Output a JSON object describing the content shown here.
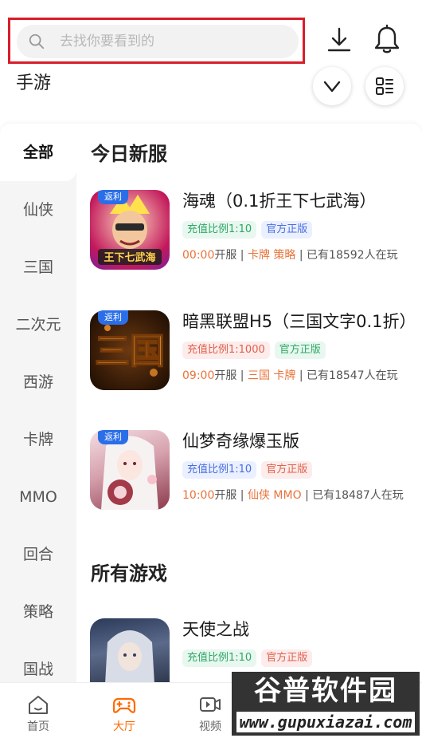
{
  "header": {
    "search_placeholder": "去找你要看到的",
    "page_title": "手游"
  },
  "sidebar": {
    "items": [
      "全部",
      "仙侠",
      "三国",
      "二次元",
      "西游",
      "卡牌",
      "MMO",
      "回合",
      "策略",
      "国战"
    ],
    "active_index": 0
  },
  "sections": {
    "new_servers_title": "今日新服",
    "all_games_title": "所有游戏"
  },
  "new_server_games": [
    {
      "name": "海魂（0.1折王下七武海）",
      "badge": "返利",
      "tags": [
        "充值比例1:10",
        "官方正版"
      ],
      "open_time": "00:00",
      "open_suffix": "开服 | ",
      "genres": "卡牌  策略",
      "players": " | 已有18592人在玩"
    },
    {
      "name": "暗黑联盟H5（三国文字0.1折）",
      "badge": "返利",
      "tags": [
        "充值比例1:1000",
        "官方正版"
      ],
      "open_time": "09:00",
      "open_suffix": "开服 | ",
      "genres": "三国  卡牌",
      "players": " | 已有18547人在玩"
    },
    {
      "name": "仙梦奇缘爆玉版",
      "badge": "返利",
      "tags": [
        "充值比例1:10",
        "官方正版"
      ],
      "open_time": "10:00",
      "open_suffix": "开服 | ",
      "genres": "仙侠  MMO",
      "players": " | 已有18487人在玩"
    }
  ],
  "all_games": [
    {
      "name": "天使之战",
      "tags": [
        "充值比例1:10",
        "官方正版"
      ]
    }
  ],
  "bottom_nav": {
    "items": [
      "首页",
      "大厅",
      "视频"
    ],
    "active_index": 1
  },
  "watermark": {
    "title": "谷普软件园",
    "url": "www.gupuxiazai.com"
  },
  "colors": {
    "accent": "#ff6a00",
    "highlight_border": "#d81e2a",
    "tag_green": "#2fa866",
    "tag_red": "#e0614a",
    "tag_blue": "#4a6ee0"
  }
}
